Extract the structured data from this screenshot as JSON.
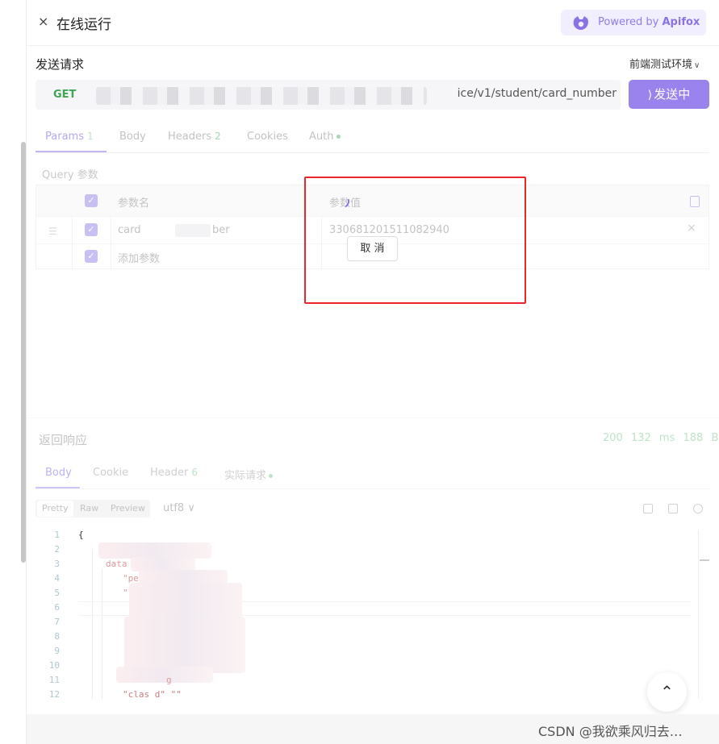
{
  "window": {
    "close_glyph": "×",
    "title": "在线运行",
    "powered_prefix": "Powered by",
    "powered_brand": "Apifox"
  },
  "request": {
    "section_title": "发送请求",
    "environment": "前端测试环境",
    "method": "GET",
    "url_visible_tail": "ice/v1/student/card_number",
    "send_label": "发送中",
    "send_spinner_glyph": "⟩"
  },
  "request_tabs": [
    {
      "label": "Params",
      "count": "1"
    },
    {
      "label": "Body"
    },
    {
      "label": "Headers",
      "count": "2"
    },
    {
      "label": "Cookies"
    },
    {
      "label": "Auth",
      "dot": true
    }
  ],
  "params": {
    "section_title": "Query 参数",
    "header_name": "参数名",
    "header_value": "参数值",
    "rows": [
      {
        "name_start": "card",
        "name_end": "ber",
        "value": "330681201511082940"
      }
    ],
    "add_placeholder": "添加参数",
    "cancel_label": "取 消"
  },
  "response": {
    "section_title": "返回响应",
    "status": "200",
    "time": "132 ms",
    "size": "188 B",
    "tabs": [
      {
        "label": "Body"
      },
      {
        "label": "Cookie"
      },
      {
        "label": "Header",
        "count": "6"
      },
      {
        "label": "实际请求",
        "dot": true
      }
    ],
    "formats": [
      "Pretty",
      "Raw",
      "Preview"
    ],
    "encoding": "utf8",
    "code_open": "{",
    "line_numbers": [
      "1",
      "2",
      "3",
      "4",
      "5",
      "6",
      "7",
      "8",
      "9",
      "10",
      "11",
      "12"
    ],
    "code_fragments": {
      "data_key": "data",
      "line4": "\"pe",
      "line5": "\"",
      "line11": "g",
      "line12": "\"clas  d\"  \"\""
    }
  },
  "watermark": "CSDN @我欲乘风归去…",
  "colors": {
    "accent": "#9b83ee",
    "method_get": "#3fa554",
    "highlight_box": "#e8262b"
  }
}
